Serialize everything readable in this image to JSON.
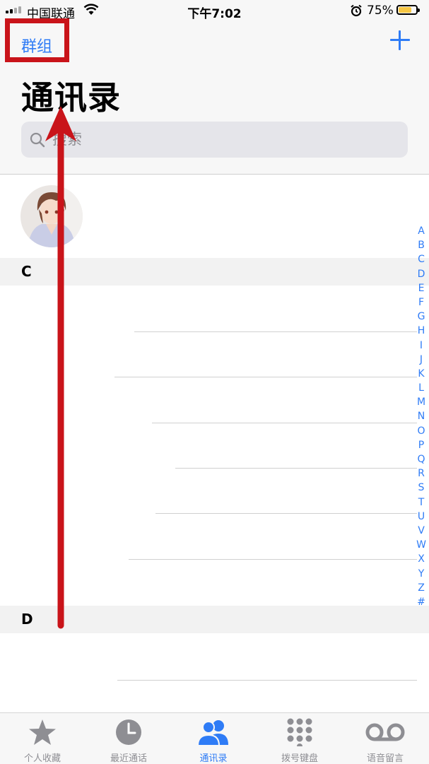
{
  "status_bar": {
    "carrier": "中国联通",
    "time": "下午7:02",
    "battery_percent": "75%",
    "battery_level": 0.75
  },
  "header": {
    "groups_label": "群组",
    "add_icon": "plus-icon",
    "title": "通讯录"
  },
  "search": {
    "placeholder": "搜索",
    "value": ""
  },
  "sections": [
    {
      "letter": "C"
    },
    {
      "letter": "D"
    }
  ],
  "index_letters": [
    "A",
    "B",
    "C",
    "D",
    "E",
    "F",
    "G",
    "H",
    "I",
    "J",
    "K",
    "L",
    "M",
    "N",
    "O",
    "P",
    "Q",
    "R",
    "S",
    "T",
    "U",
    "V",
    "W",
    "X",
    "Y",
    "Z",
    "#"
  ],
  "tabs": [
    {
      "label": "个人收藏",
      "icon": "star-icon",
      "active": false
    },
    {
      "label": "最近通话",
      "icon": "clock-icon",
      "active": false
    },
    {
      "label": "通讯录",
      "icon": "contacts-icon",
      "active": true
    },
    {
      "label": "拨号键盘",
      "icon": "keypad-icon",
      "active": false
    },
    {
      "label": "语音留言",
      "icon": "voicemail-icon",
      "active": false
    }
  ],
  "colors": {
    "accent": "#2f7cf6",
    "annotation_red": "#c9141a",
    "battery": "#f7c744"
  }
}
